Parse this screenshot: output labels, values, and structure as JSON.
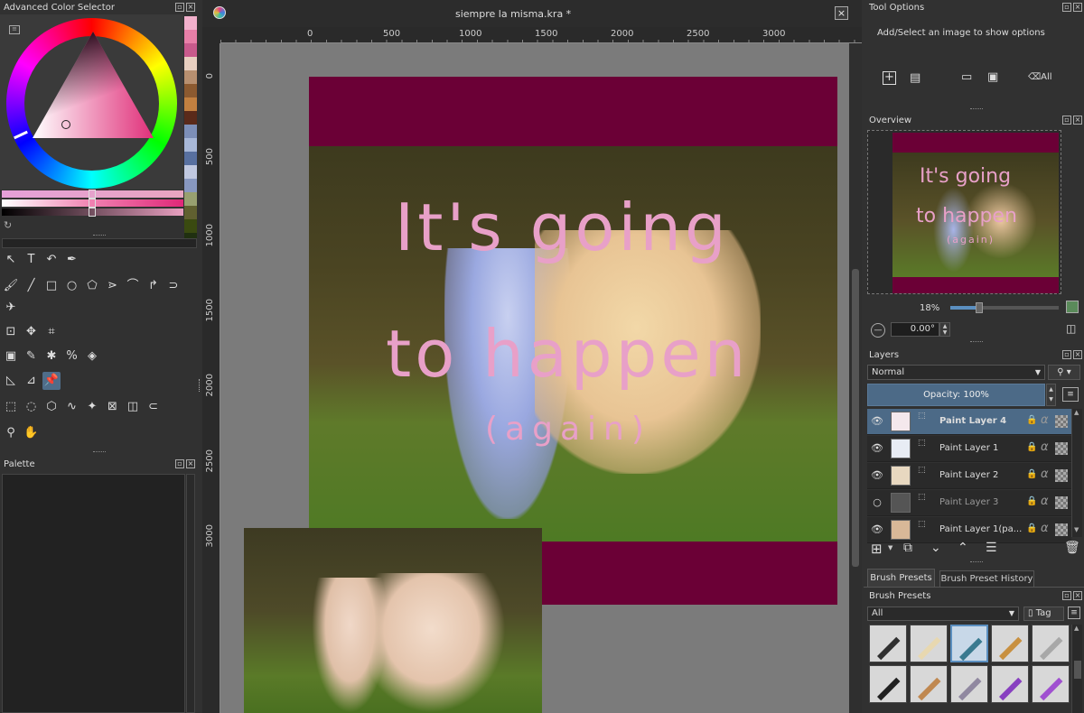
{
  "colors": {
    "accent": "#4c6a87",
    "canvas_bg": "#7b7b7b",
    "maroon": "#6b0036",
    "pink_text": "#e8a0c8"
  },
  "left": {
    "color_selector_title": "Advanced Color Selector",
    "swatches": [
      "#f2b0cc",
      "#e87fa8",
      "#c85a8c",
      "#e8cfc0",
      "#b89070",
      "#8c5a30",
      "#c28040",
      "#5a2a1a",
      "#7d8fb8",
      "#a8b8d8",
      "#5870a0",
      "#c0c8e0",
      "#8898c0",
      "#98a070",
      "#606030",
      "#3a4a10",
      "#203010"
    ],
    "toolbox_icons": [
      "pointer-icon",
      "text-icon",
      "calligraphy-icon",
      "fill-shape-icon",
      "freehand-brush-icon",
      "line-icon",
      "rectangle-icon",
      "ellipse-icon",
      "polygon-icon",
      "polyline-icon",
      "bezier-icon",
      "freehand-path-icon",
      "dynamic-brush-icon",
      "multibrush-icon",
      "crop-transform-icon",
      "move-icon",
      "crop-icon",
      "gradient-icon",
      "color-picker-icon",
      "smart-patch-icon",
      "colorize-mask-icon",
      "fill-icon",
      "assistant-icon",
      "measure-icon",
      "reference-images-icon",
      "rect-select-icon",
      "ellipse-select-icon",
      "polygon-select-icon",
      "freehand-select-icon",
      "contiguous-select-icon",
      "similar-select-icon",
      "bezier-select-icon",
      "magnetic-select-icon",
      "zoom-icon",
      "pan-icon"
    ],
    "palette_title": "Palette"
  },
  "document": {
    "title": "siempre la misma.kra *",
    "hruler": [
      "0",
      "500",
      "1000",
      "1500",
      "2000",
      "2500",
      "3000"
    ],
    "vruler": [
      "0",
      "500",
      "1000",
      "1500",
      "2000",
      "2500",
      "3000"
    ],
    "text_line1": "It's going",
    "text_line2": "to happen",
    "text_line3": "(again)"
  },
  "right": {
    "tool_options_title": "Tool Options",
    "tool_options_msg": "Add/Select an image to show options",
    "all_label": "All",
    "overview_title": "Overview",
    "zoom": "18%",
    "rotation": "0.00°",
    "layers_title": "Layers",
    "blend_mode": "Normal",
    "opacity": "Opacity:  100%",
    "layers": [
      {
        "name": "Paint Layer 4",
        "visible": true,
        "selected": true
      },
      {
        "name": "Paint Layer 1",
        "visible": true,
        "selected": false
      },
      {
        "name": "Paint Layer 2",
        "visible": true,
        "selected": false
      },
      {
        "name": "Paint Layer 3",
        "visible": false,
        "selected": false
      },
      {
        "name": "Paint Layer 1(pa...",
        "visible": true,
        "selected": false
      }
    ],
    "tab_brush_presets": "Brush Presets",
    "tab_brush_history": "Brush Preset History",
    "brush_presets_title": "Brush Presets",
    "brush_filter": "All",
    "tag_label": "Tag"
  }
}
